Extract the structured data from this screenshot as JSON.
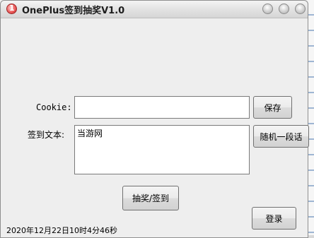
{
  "window": {
    "title": "OnePlus签到抽奖V1.0"
  },
  "form": {
    "cookie_label": "Cookie:",
    "cookie_value": "",
    "save_label": "保存",
    "sign_text_label": "签到文本:",
    "sign_text_value": "当游网",
    "random_label": "随机一段话",
    "lottery_label": "抽奖/签到",
    "login_label": "登录"
  },
  "status": {
    "datetime": "2020年12月22日10时4分46秒"
  }
}
